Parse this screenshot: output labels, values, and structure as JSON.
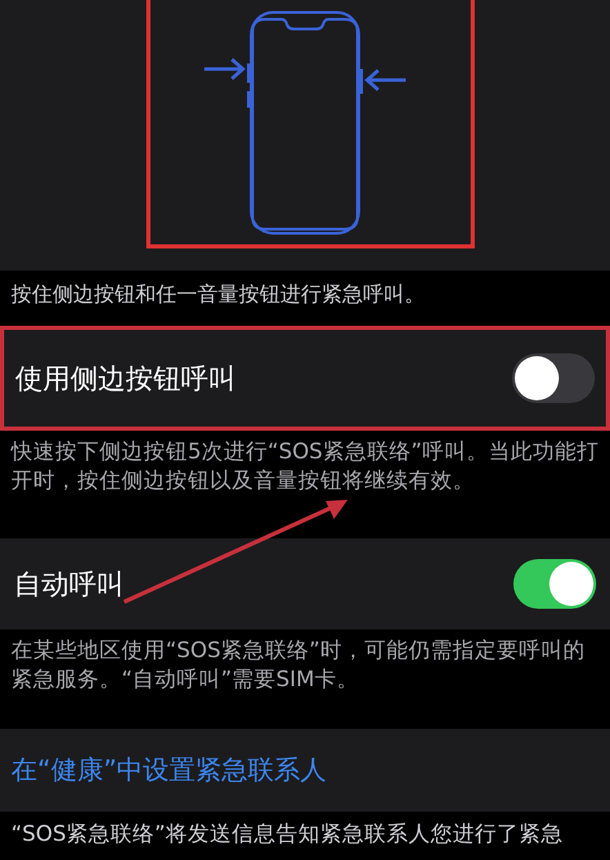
{
  "instruction": "按住侧边按钮和任一音量按钮进行紧急呼叫。",
  "settings": [
    {
      "kind": "toggle",
      "label": "使用侧边按钮呼叫",
      "on": false,
      "highlighted": true,
      "footer": "快速按下侧边按钮5次进行“SOS紧急联络”呼叫。当此功能打开时，按住侧边按钮以及音量按钮将继续有效。"
    },
    {
      "kind": "toggle",
      "label": "自动呼叫",
      "on": true,
      "highlighted": false,
      "footer": "在某些地区使用“SOS紧急联络”时，可能仍需指定要呼叫的紧急服务。“自动呼叫”需要SIM卡。"
    }
  ],
  "link": "在“健康”中设置紧急联系人",
  "bottom_text": "“SOS紧急联络”将发送信息告知紧急联系人您进行了紧急"
}
